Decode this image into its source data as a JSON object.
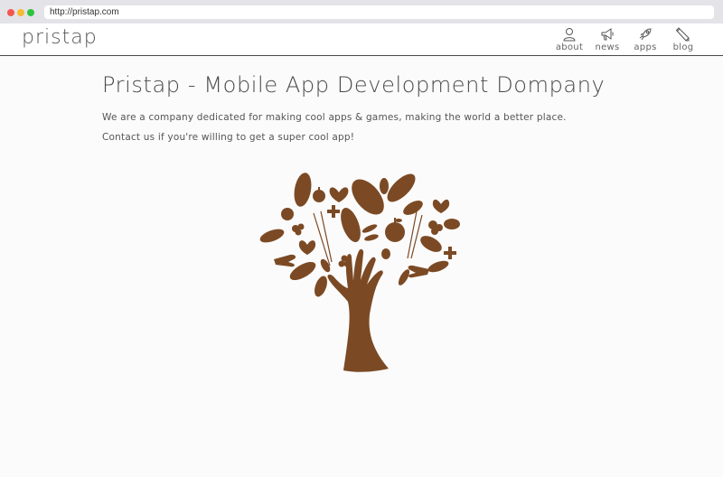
{
  "browser": {
    "url": "http://pristap.com"
  },
  "header": {
    "logo": "pristap",
    "nav": [
      {
        "label": "about",
        "icon": "person-icon"
      },
      {
        "label": "news",
        "icon": "megaphone-icon"
      },
      {
        "label": "apps",
        "icon": "rocket-icon"
      },
      {
        "label": "blog",
        "icon": "pencil-icon"
      }
    ]
  },
  "main": {
    "title": "Pristap - Mobile App Development Dompany",
    "paragraph1": "We are a company dedicated for making cool apps & games, making the world a better place.",
    "paragraph2": "Contact us if you're willing to get a super cool app!"
  },
  "colors": {
    "tree": "#7b4a24",
    "text": "#4a4a4a",
    "background": "#fcfbfc"
  }
}
